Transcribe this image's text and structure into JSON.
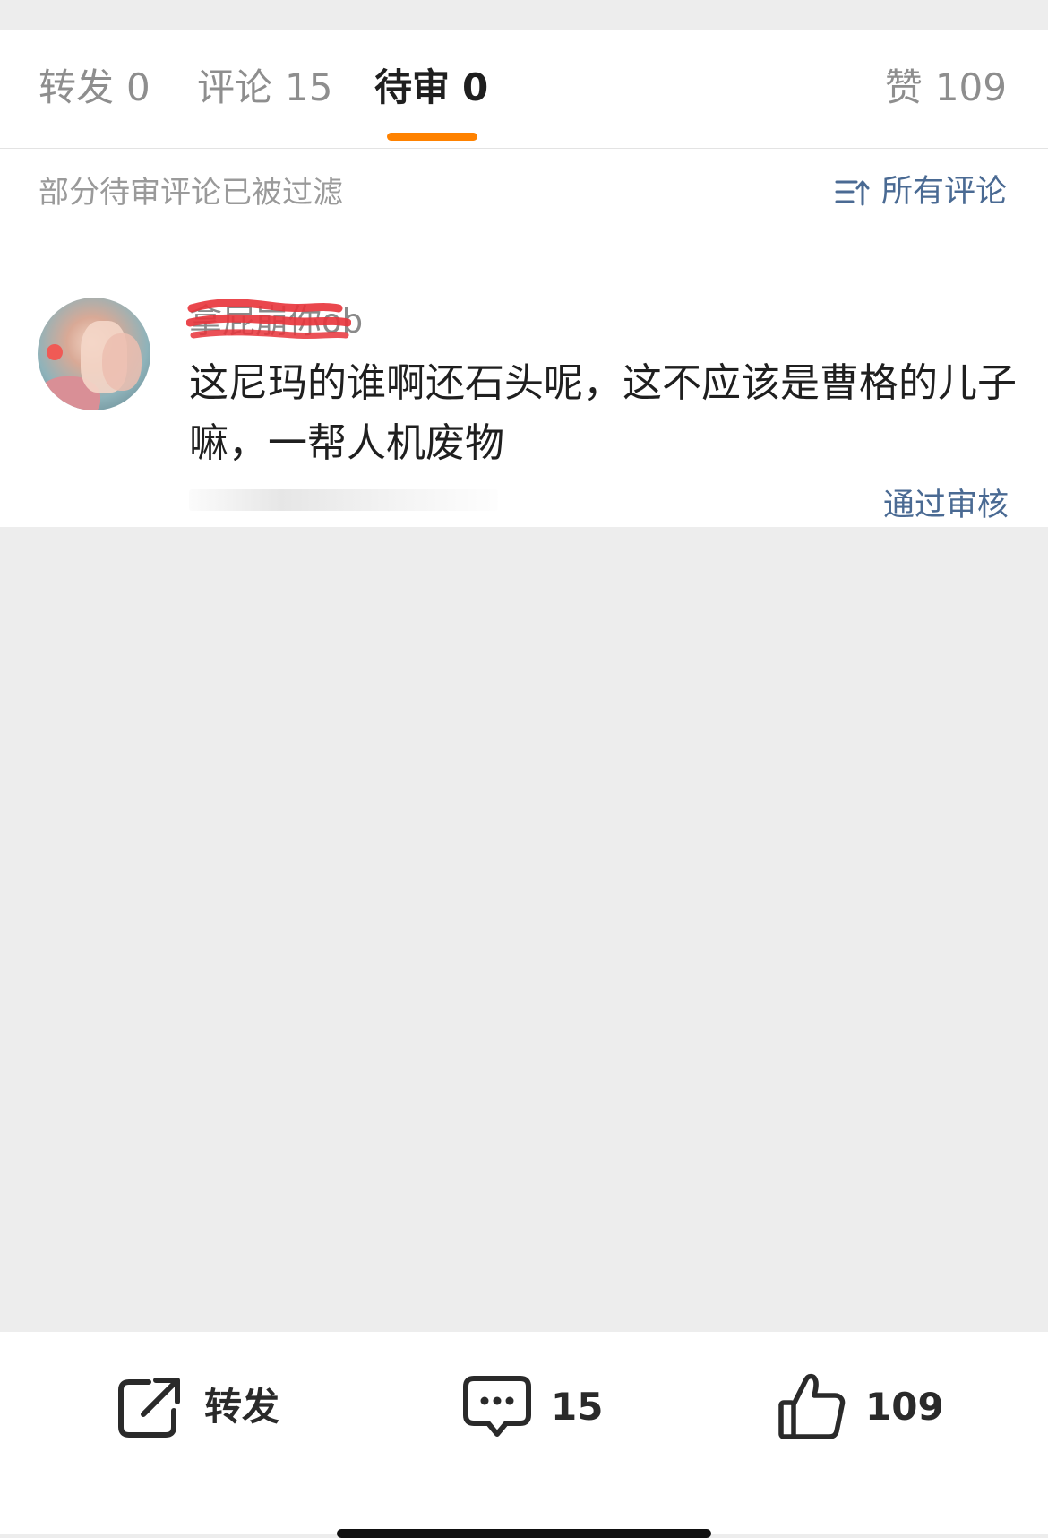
{
  "tabs": {
    "repost": {
      "label": "转发",
      "count": "0"
    },
    "comments": {
      "label": "评论",
      "count": "15"
    },
    "pending": {
      "label": "待审",
      "count": "0"
    },
    "likes": {
      "label": "赞",
      "count": "109"
    }
  },
  "filter_bar": {
    "note": "部分待审评论已被过滤",
    "sort_label": "所有评论",
    "sort_icon": "sort-list-icon"
  },
  "comment": {
    "username": "拿屁崩你ob",
    "text": "这尼玛的谁啊还石头呢，这不应该是曹格的儿子嘛，一帮人机废物",
    "approve_label": "通过审核"
  },
  "bottom_bar": {
    "repost": {
      "label": "转发",
      "icon": "share-icon"
    },
    "comment": {
      "count": "15",
      "icon": "comment-icon"
    },
    "like": {
      "count": "109",
      "icon": "thumbs-up-icon"
    }
  },
  "colors": {
    "accent_orange": "#ff8200",
    "link_blue": "#4a6a93",
    "page_background": "#ededed",
    "redaction_red": "#e8333a"
  }
}
